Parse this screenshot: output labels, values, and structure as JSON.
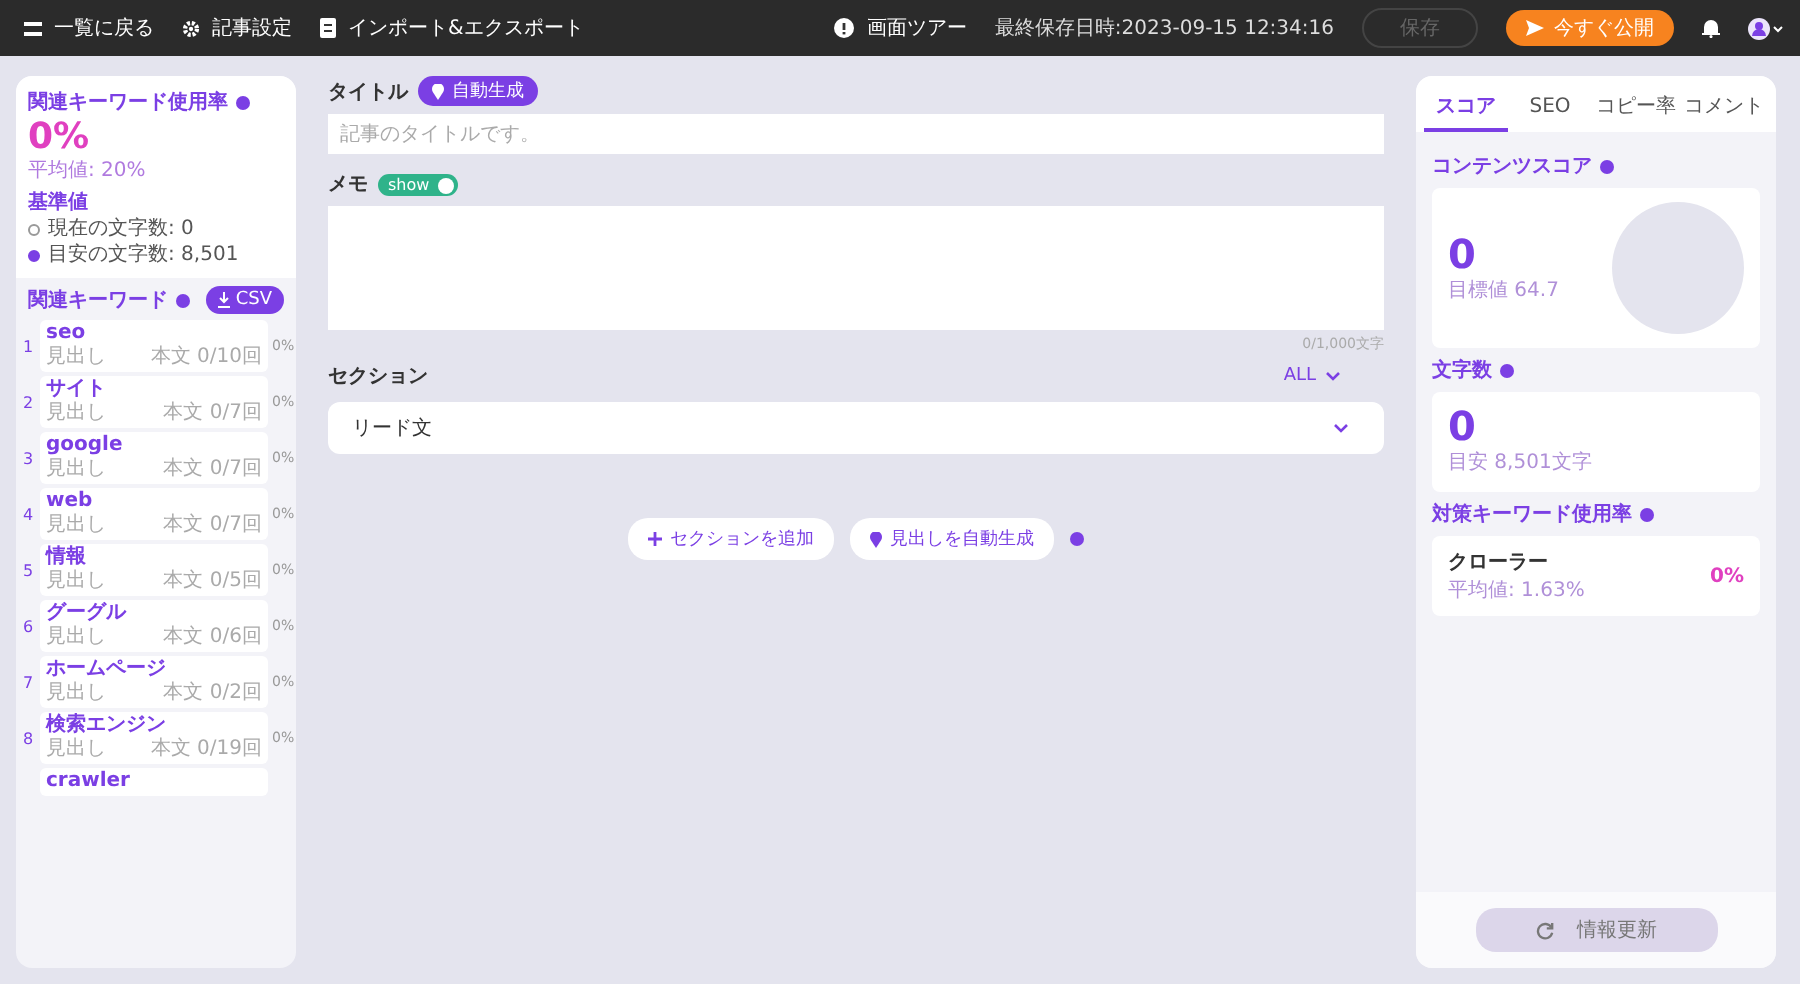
{
  "topbar": {
    "left": [
      {
        "label": "一覧に戻る"
      },
      {
        "label": "記事設定"
      },
      {
        "label": "インポート&エクスポート"
      }
    ],
    "tour": "画面ツアー",
    "saved": "最終保存日時:2023-09-15 12:34:16",
    "save": {
      "label": "保存",
      "disabled": true
    },
    "publish": "今すぐ公開"
  },
  "left": {
    "title": "関連キーワード使用率",
    "rate": "0%",
    "average": "平均値: 20%",
    "basis_title": "基準値",
    "basis": [
      {
        "label": "現在の文字数: 0",
        "selected": false
      },
      {
        "label": "目安の文字数: 8,501",
        "selected": true
      }
    ],
    "kw_title": "関連キーワード",
    "csv": "CSV",
    "keywords": [
      {
        "index": "1",
        "word": "seo",
        "heading": "見出し",
        "body": "本文 0/10回",
        "percent": "0%"
      },
      {
        "index": "2",
        "word": "サイト",
        "heading": "見出し",
        "body": "本文 0/7回",
        "percent": "0%"
      },
      {
        "index": "3",
        "word": "google",
        "heading": "見出し",
        "body": "本文 0/7回",
        "percent": "0%"
      },
      {
        "index": "4",
        "word": "web",
        "heading": "見出し",
        "body": "本文 0/7回",
        "percent": "0%"
      },
      {
        "index": "5",
        "word": "情報",
        "heading": "見出し",
        "body": "本文 0/5回",
        "percent": "0%"
      },
      {
        "index": "6",
        "word": "グーグル",
        "heading": "見出し",
        "body": "本文 0/6回",
        "percent": "0%"
      },
      {
        "index": "7",
        "word": "ホームページ",
        "heading": "見出し",
        "body": "本文 0/2回",
        "percent": "0%"
      },
      {
        "index": "8",
        "word": "検索エンジン",
        "heading": "見出し",
        "body": "本文 0/19回",
        "percent": "0%"
      },
      {
        "word": "crawler"
      }
    ]
  },
  "editor": {
    "title_label": "タイトル",
    "auto": "自動生成",
    "title_placeholder": "記事のタイトルです。",
    "memo_label": "メモ",
    "memo_toggle": {
      "label": "show",
      "on": true
    },
    "counter": "0/1,000文字",
    "section_label": "セクション",
    "filter": "ALL",
    "sections": [
      {
        "label": "リード文"
      }
    ],
    "add_section": "セクションを追加",
    "auto_heading": "見出しを自動生成"
  },
  "right": {
    "tabs": [
      {
        "label": "スコア",
        "selected": true
      },
      {
        "label": "SEO",
        "selected": false
      },
      {
        "label": "コピー率",
        "selected": false
      },
      {
        "label": "コメント",
        "selected": false
      }
    ],
    "content_score": {
      "title": "コンテンツスコア",
      "value": "0",
      "target": "目標値 64.7"
    },
    "chars": {
      "title": "文字数",
      "value": "0",
      "target": "目安 8,501文字"
    },
    "kw_rate": {
      "title": "対策キーワード使用率",
      "items": [
        {
          "word": "クローラー",
          "average": "平均値: 1.63%",
          "percent": "0%"
        }
      ]
    },
    "refresh": {
      "label": "情報更新",
      "disabled": true
    }
  }
}
